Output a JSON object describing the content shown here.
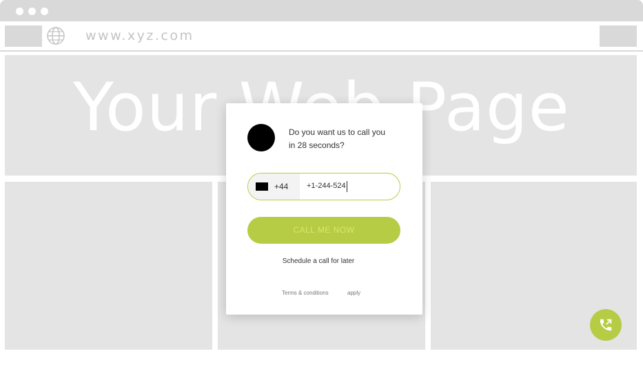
{
  "browser": {
    "url": "www.xyz.com"
  },
  "page": {
    "hero_text": "Your Web Page"
  },
  "widget": {
    "question": "Do you want us to call you in 28 seconds?",
    "country_code": "+44",
    "phone_value": "+1-244-524",
    "call_button_label": "CALL ME NOW",
    "schedule_label": "Schedule a call for later",
    "terms_label": "Terms & conditions",
    "apply_label": "apply",
    "accent_color": "#b7cc45"
  },
  "fab": {
    "icon": "phone-call-icon"
  }
}
